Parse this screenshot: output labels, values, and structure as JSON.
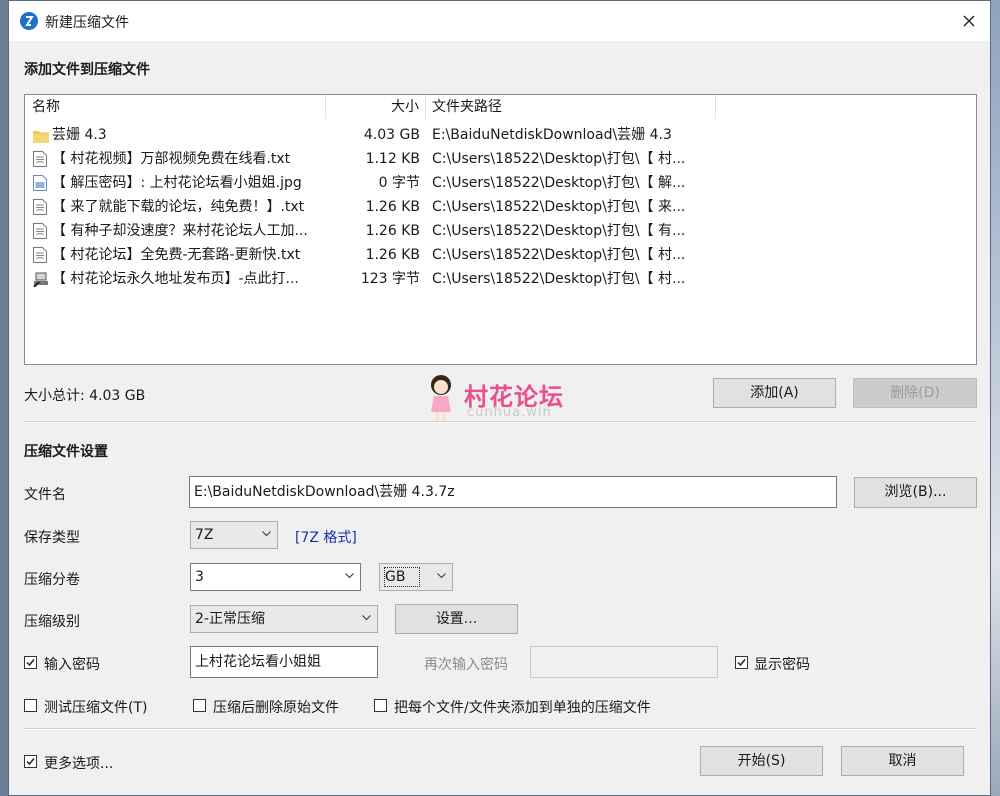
{
  "window": {
    "title": "新建压缩文件"
  },
  "section_add": {
    "heading": "添加文件到压缩文件"
  },
  "columns": {
    "name": "名称",
    "size": "大小",
    "path": "文件夹路径"
  },
  "files": [
    {
      "name": "芸姗 4.3",
      "size": "4.03 GB",
      "path": "E:\\BaiduNetdiskDownload\\芸姗 4.3",
      "icon": "folder-icon"
    },
    {
      "name": "【 村花视频】万部视频免费在线看.txt",
      "size": "1.12 KB",
      "path": "C:\\Users\\18522\\Desktop\\打包\\【 村...",
      "icon": "text-file-icon"
    },
    {
      "name": "【 解压密码】: 上村花论坛看小姐姐.jpg",
      "size": "0 字节",
      "path": "C:\\Users\\18522\\Desktop\\打包\\【 解...",
      "icon": "image-file-icon"
    },
    {
      "name": "【 来了就能下载的论坛，纯免费！】.txt",
      "size": "1.26 KB",
      "path": "C:\\Users\\18522\\Desktop\\打包\\【 来...",
      "icon": "text-file-icon"
    },
    {
      "name": "【 有种子却没速度？来村花论坛人工加...",
      "size": "1.26 KB",
      "path": "C:\\Users\\18522\\Desktop\\打包\\【 有...",
      "icon": "text-file-icon"
    },
    {
      "name": "【 村花论坛】全免费-无套路-更新快.txt",
      "size": "1.26 KB",
      "path": "C:\\Users\\18522\\Desktop\\打包\\【 村...",
      "icon": "text-file-icon"
    },
    {
      "name": "【 村花论坛永久地址发布页】-点此打...",
      "size": "123 字节",
      "path": "C:\\Users\\18522\\Desktop\\打包\\【 村...",
      "icon": "shortcut-file-icon"
    }
  ],
  "total_size": "大小总计: 4.03 GB",
  "watermark": {
    "text": "村花论坛",
    "sub": "cunhua.win"
  },
  "buttons": {
    "add": "添加(A)",
    "delete": "删除(D)",
    "browse": "浏览(B)...",
    "settings": "设置...",
    "start": "开始(S)",
    "cancel": "取消"
  },
  "section_settings": {
    "heading": "压缩文件设置"
  },
  "filename": {
    "label": "文件名",
    "value": "E:\\BaiduNetdiskDownload\\芸姗 4.3.7z"
  },
  "save_type": {
    "label": "保存类型",
    "value": "7Z",
    "format_link": "[7Z 格式]"
  },
  "split": {
    "label": "压缩分卷",
    "value": "3",
    "unit": "GB"
  },
  "level": {
    "label": "压缩级别",
    "value": "2-正常压缩"
  },
  "password": {
    "label": "输入密码",
    "value": "上村花论坛看小姐姐",
    "checked": true,
    "reenter_label": "再次输入密码",
    "show_label": "显示密码",
    "show_checked": true
  },
  "options": {
    "test": "测试压缩文件(T)",
    "delete_after": "压缩后删除原始文件",
    "each_separate": "把每个文件/文件夹添加到单独的压缩文件",
    "more": "更多选项..."
  },
  "colors": {
    "watermark": "#ec4f8e",
    "link": "#1530b0",
    "app_icon": "#1e6fd0"
  }
}
